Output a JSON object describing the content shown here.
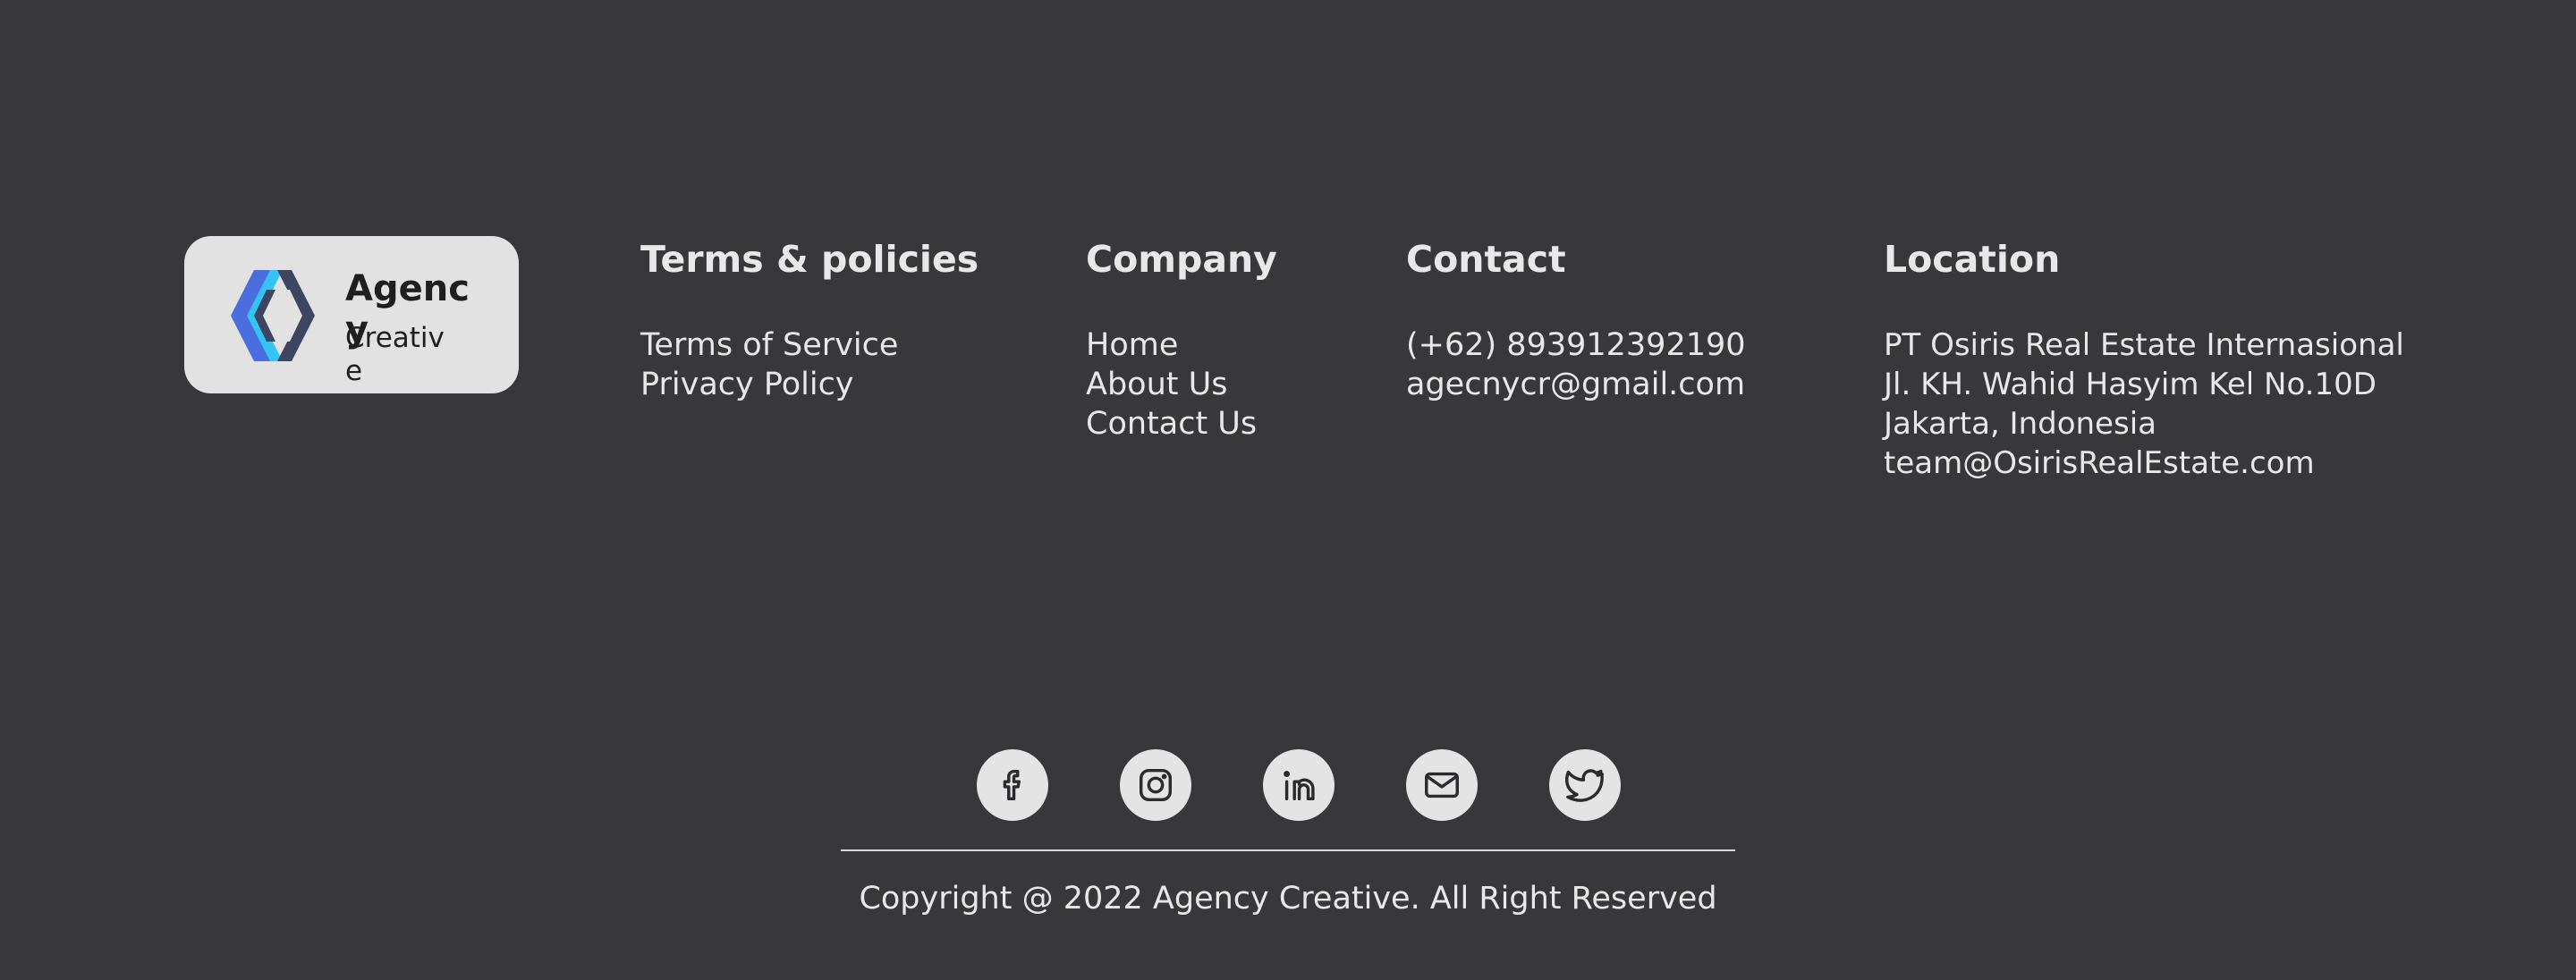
{
  "brand": {
    "name": "Agency",
    "subtitle": "Creative",
    "icon": "chevron-diamond-logo",
    "colors": {
      "dark": "#3e4560",
      "blue": "#4a6ee0",
      "cyan": "#33c3f5"
    }
  },
  "columns": {
    "terms": {
      "title": "Terms & policies",
      "items": [
        "Terms of Service",
        "Privacy Policy"
      ]
    },
    "company": {
      "title": "Company",
      "items": [
        "Home",
        "About Us",
        "Contact Us"
      ]
    },
    "contact": {
      "title": "Contact",
      "items": [
        "(+62) 893912392190",
        "agecnycr@gmail.com"
      ]
    },
    "location": {
      "title": "Location",
      "items": [
        "PT Osiris Real Estate Internasional",
        "Jl. KH. Wahid Hasyim Kel No.10D",
        "Jakarta, Indonesia",
        "team@OsirisRealEstate.com"
      ]
    }
  },
  "social": [
    {
      "icon": "facebook-icon"
    },
    {
      "icon": "instagram-icon"
    },
    {
      "icon": "linkedin-icon"
    },
    {
      "icon": "mail-icon"
    },
    {
      "icon": "twitter-icon"
    }
  ],
  "footer": {
    "copyright": "Copyright @ 2022 Agency Creative. All Right Reserved"
  },
  "colors": {
    "background": "#38373a",
    "text": "#e8e8e8",
    "logo_bg": "#e2e2e2"
  }
}
